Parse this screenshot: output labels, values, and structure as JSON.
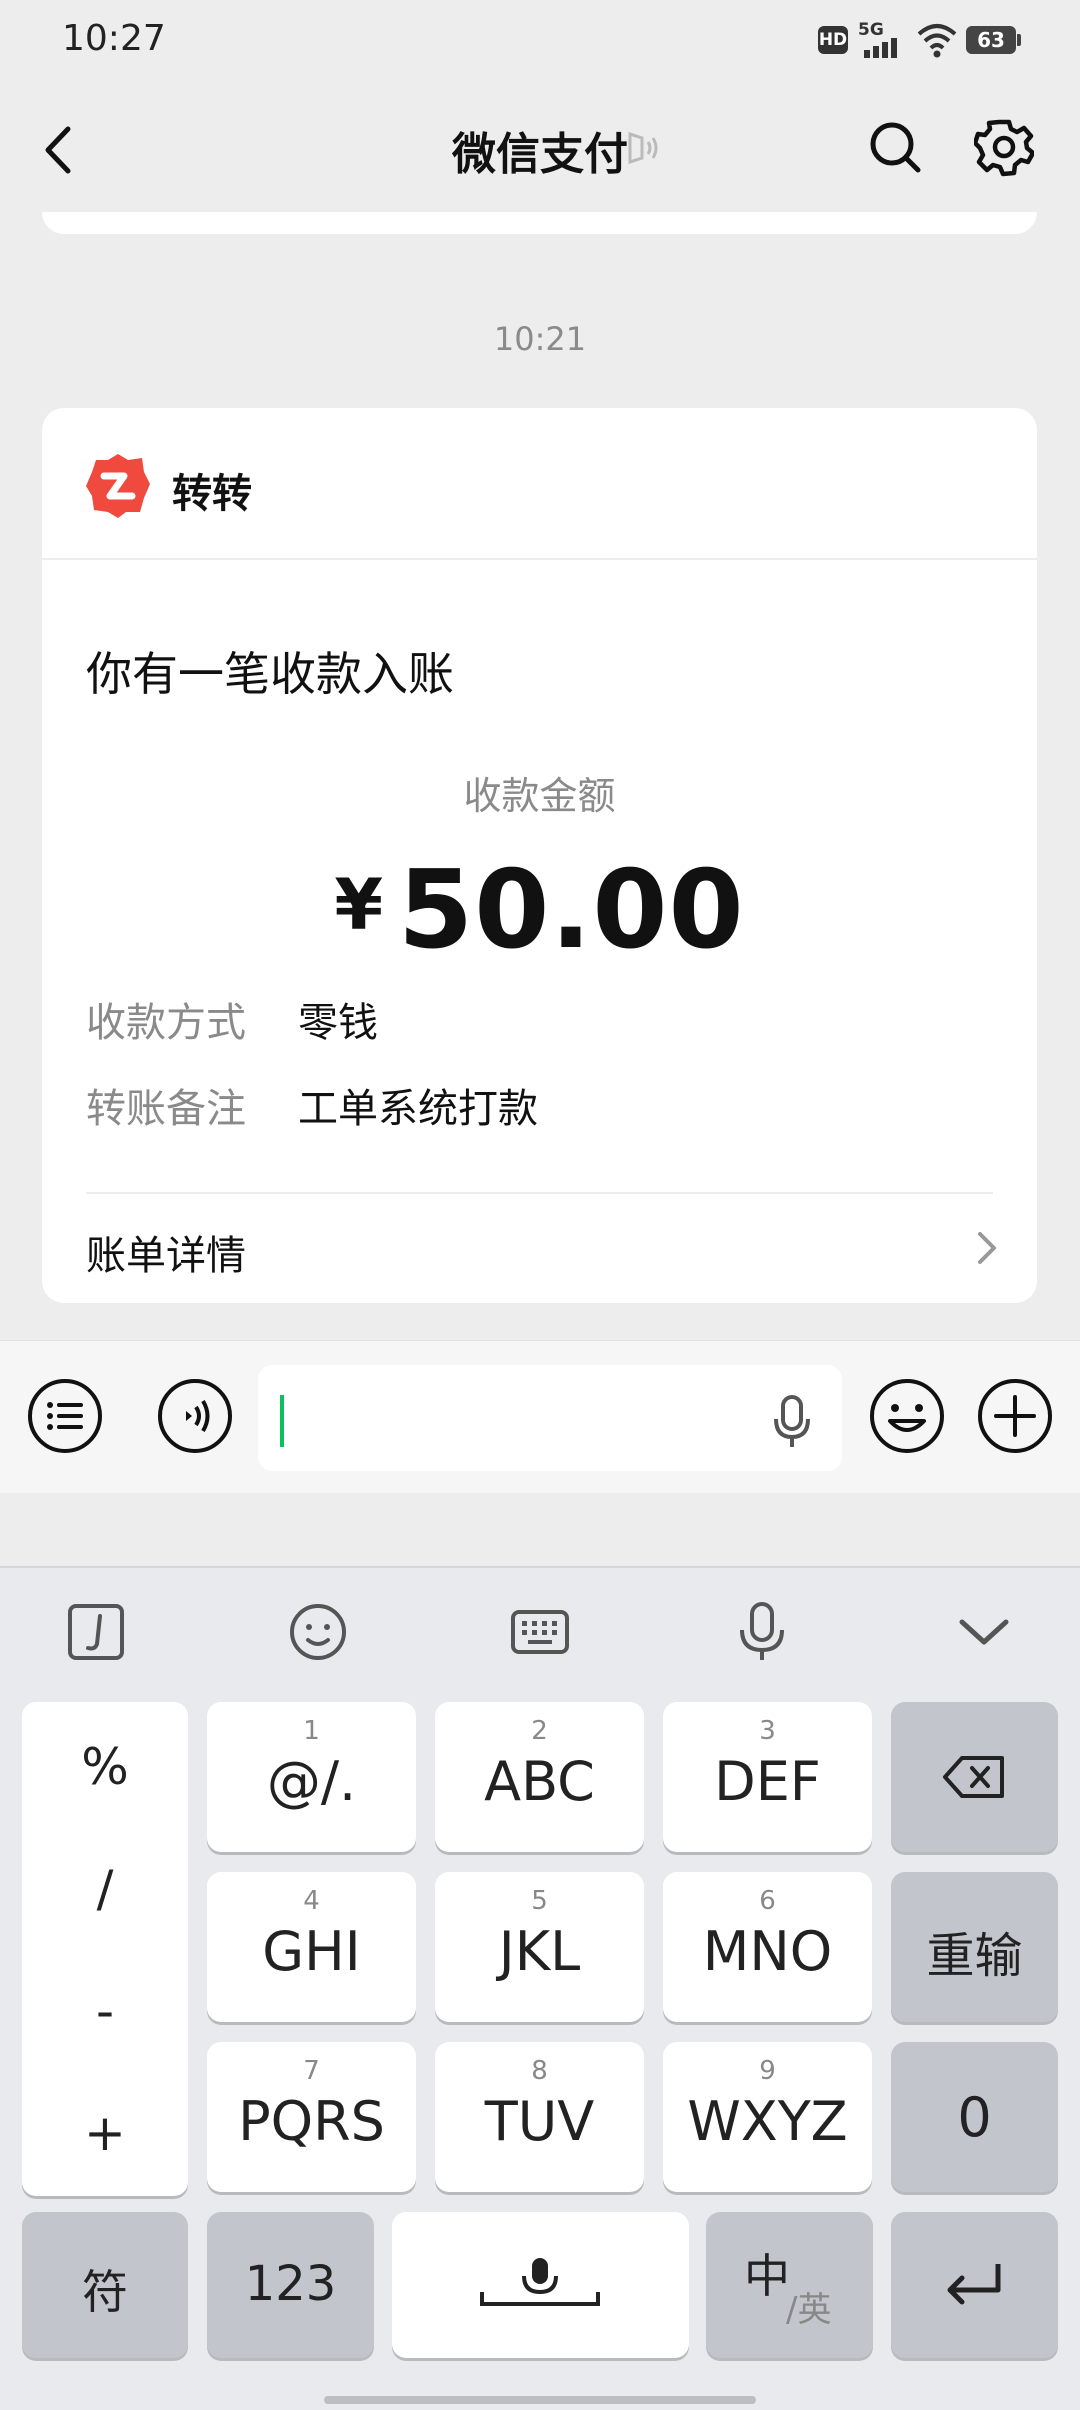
{
  "status_bar": {
    "time": "10:27",
    "hd": "HD",
    "network": "5G",
    "battery": "63"
  },
  "header": {
    "title": "微信支付",
    "back_icon": "back-icon",
    "search_icon": "search-icon",
    "settings_icon": "gear-icon"
  },
  "chat": {
    "message_time": "10:21",
    "card": {
      "app_name": "转转",
      "headline": "你有一笔收款入账",
      "amount_label": "收款金额",
      "currency": "¥",
      "amount": "50.00",
      "rows": [
        {
          "key": "收款方式",
          "value": "零钱"
        },
        {
          "key": "转账备注",
          "value": "工单系统打款"
        }
      ],
      "bill_detail": "账单详情"
    }
  },
  "input_bar": {
    "text": ""
  },
  "keyboard": {
    "symbols": [
      "%",
      "/",
      "-",
      "+"
    ],
    "keys": [
      {
        "num": "1",
        "label": "@/."
      },
      {
        "num": "2",
        "label": "ABC"
      },
      {
        "num": "3",
        "label": "DEF"
      },
      {
        "num": "4",
        "label": "GHI"
      },
      {
        "num": "5",
        "label": "JKL"
      },
      {
        "num": "6",
        "label": "MNO"
      },
      {
        "num": "7",
        "label": "PQRS"
      },
      {
        "num": "8",
        "label": "TUV"
      },
      {
        "num": "9",
        "label": "WXYZ"
      }
    ],
    "reenter": "重输",
    "zero": "0",
    "symbol_key": "符",
    "num_key": "123",
    "lang_main": "中",
    "lang_sub": "/英"
  },
  "colors": {
    "accent_green": "#07c160",
    "brand_red": "#f04a3e"
  }
}
